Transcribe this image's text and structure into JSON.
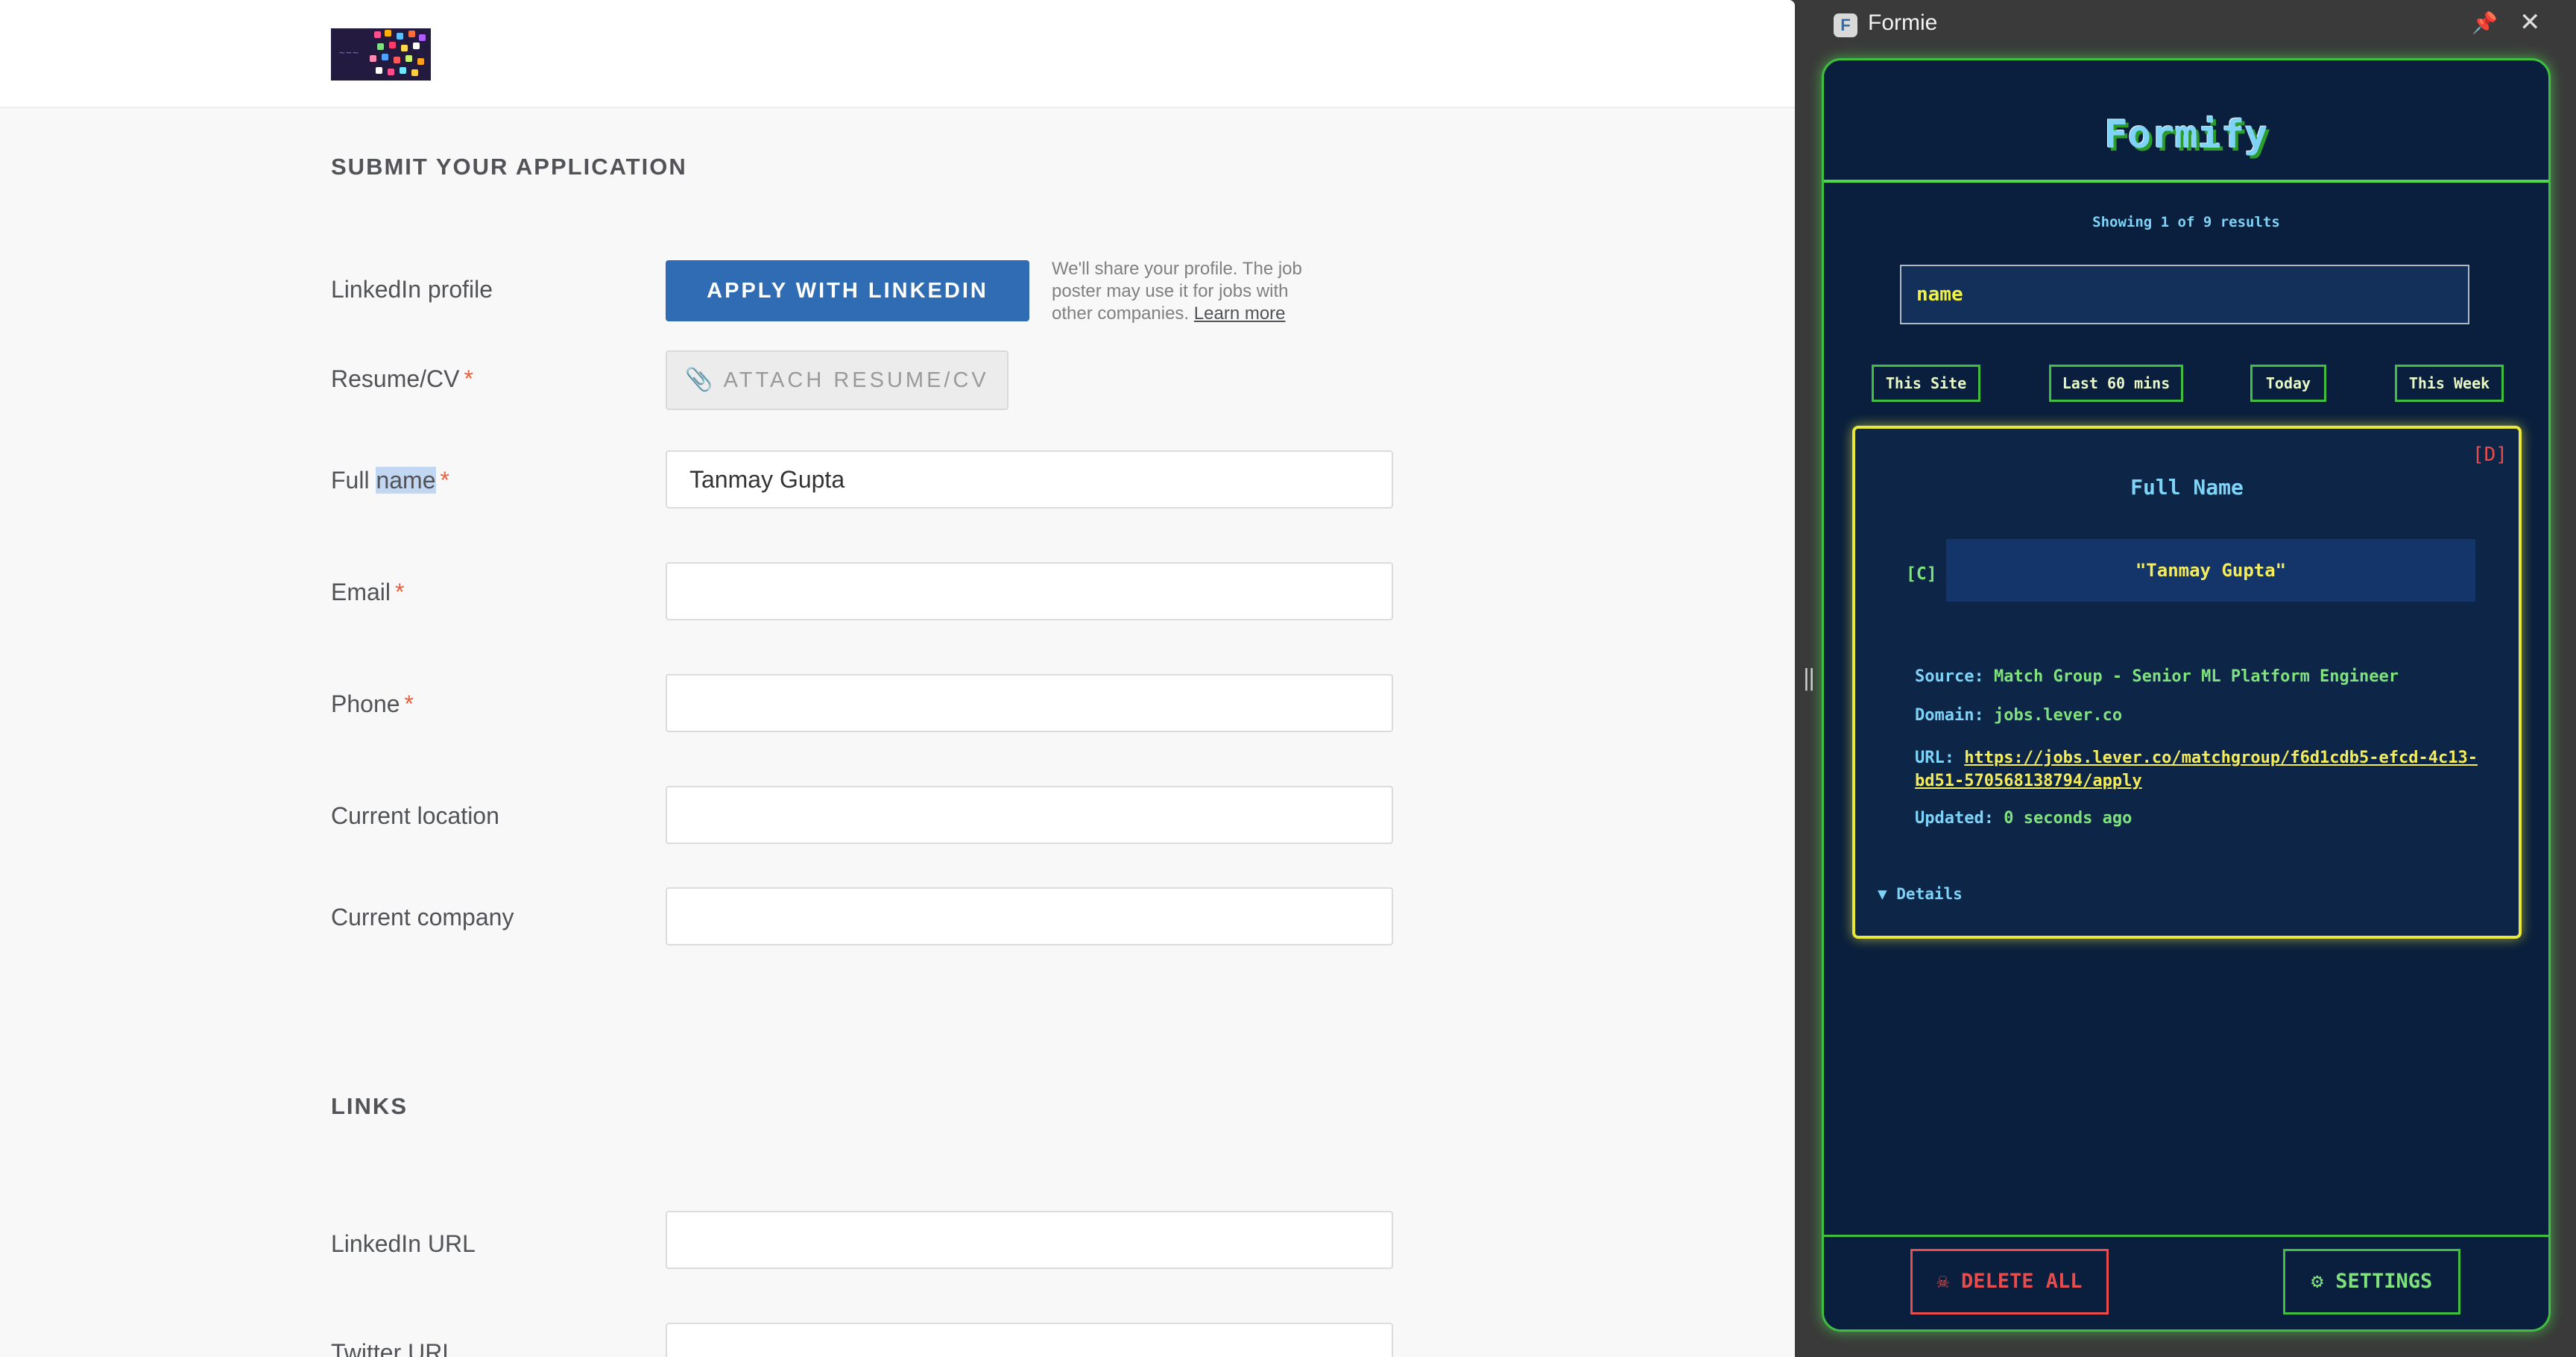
{
  "page": {
    "section_application": "SUBMIT YOUR APPLICATION",
    "section_links": "LINKS",
    "linkedin": {
      "label": "LinkedIn profile",
      "button": "APPLY WITH LINKEDIN",
      "note": "We'll share your profile. The job poster may use it for jobs with other companies.",
      "learn_more": "Learn more"
    },
    "resume": {
      "label": "Resume/CV",
      "button": "ATTACH RESUME/CV"
    },
    "fields": {
      "full_name": {
        "label_prefix": "Full ",
        "label_highlight": "name",
        "value": "Tanmay Gupta"
      },
      "email": {
        "label": "Email",
        "value": ""
      },
      "phone": {
        "label": "Phone",
        "value": ""
      },
      "location": {
        "label": "Current location",
        "value": ""
      },
      "company": {
        "label": "Current company",
        "value": ""
      },
      "linkedin_url": {
        "label": "LinkedIn URL",
        "value": ""
      },
      "twitter_url": {
        "label": "Twitter URL",
        "value": ""
      }
    },
    "required_mark": "*"
  },
  "panel": {
    "window_title": "Formie",
    "icons": {
      "app": "formie-app-icon",
      "pin": "pin-icon",
      "close": "close-icon",
      "clip": "paperclip-icon"
    },
    "title": "Formify",
    "results": "Showing 1 of 9 results",
    "search_value": "name",
    "filters": [
      "This Site",
      "Last 60 mins",
      "Today",
      "This Week"
    ],
    "entry": {
      "delete": "[D]",
      "field_title": "Full Name",
      "copy": "[C]",
      "value": "\"Tanmay Gupta\"",
      "source_label": "Source:",
      "source": "Match Group - Senior ML Platform Engineer",
      "domain_label": "Domain:",
      "domain": "jobs.lever.co",
      "url_label": "URL:",
      "url": "https://jobs.lever.co/matchgroup/f6d1cdb5-efcd-4c13-bd51-570568138794/apply",
      "updated_label": "Updated:",
      "updated": "0 seconds ago",
      "details": "▼ Details"
    },
    "footer": {
      "delete_all": "☠ DELETE ALL",
      "settings": "⚙ SETTINGS"
    }
  },
  "colors": {
    "linkedin_blue": "#2f6cb3",
    "required": "#e8603c",
    "panel_bg": "#0a1f3d",
    "neon_green": "#3fbf3f",
    "neon_yellow": "#e9e83a",
    "danger_red": "#e84c4c",
    "cyan_text": "#7fd3f7"
  }
}
